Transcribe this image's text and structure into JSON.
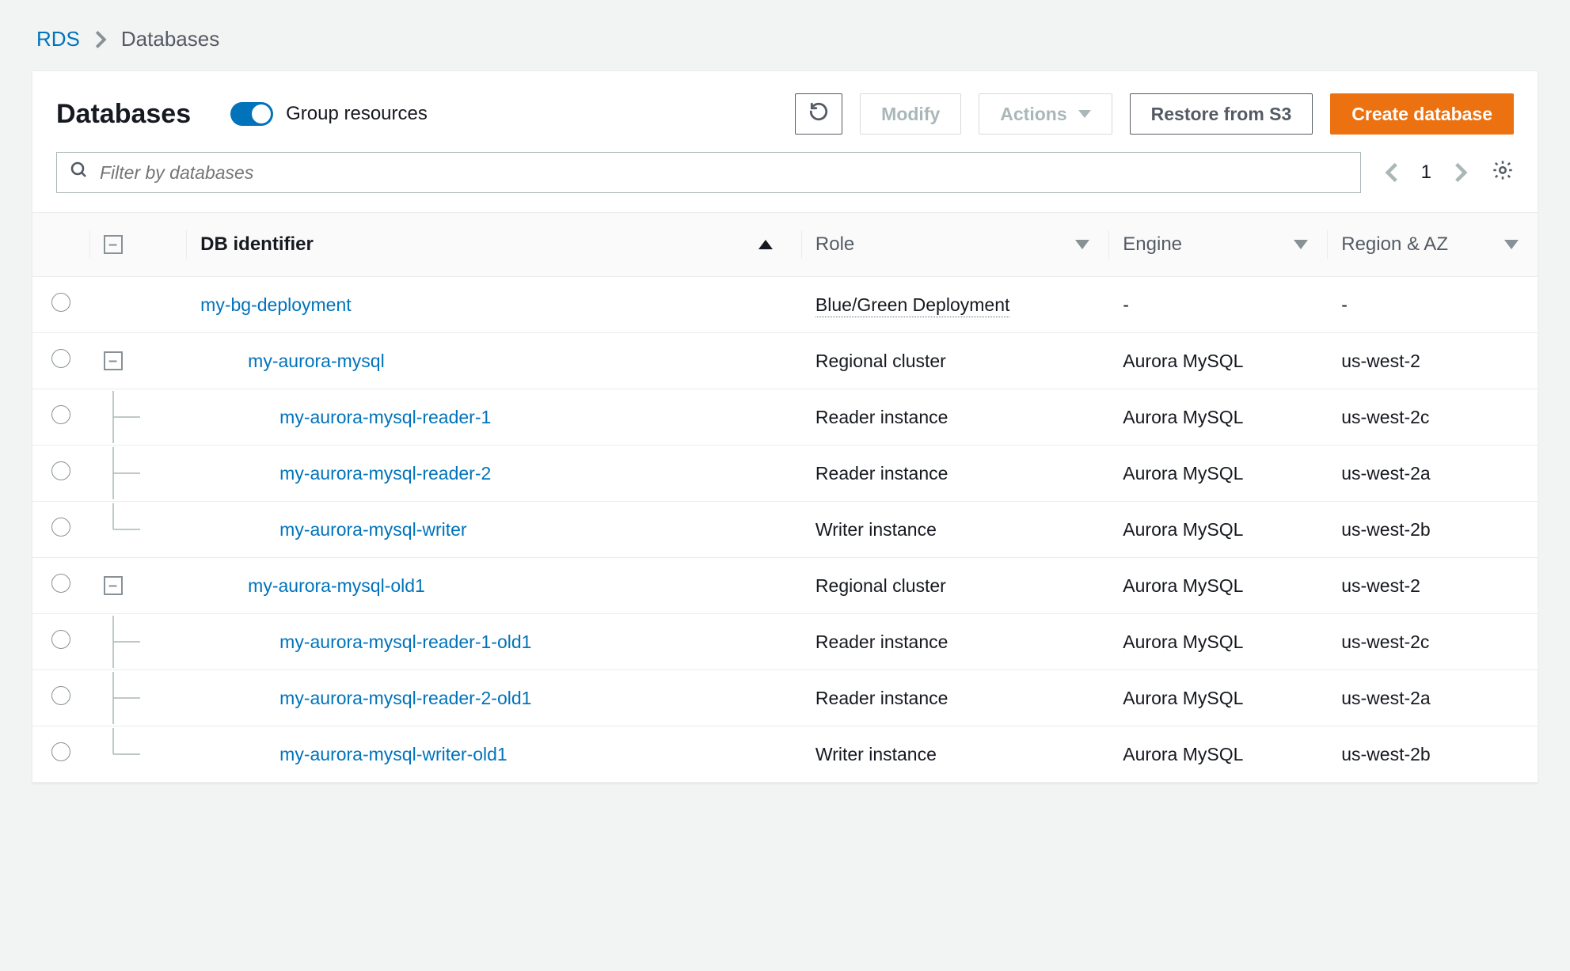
{
  "breadcrumb": {
    "root": "RDS",
    "current": "Databases"
  },
  "header": {
    "title": "Databases",
    "group_toggle_label": "Group resources",
    "buttons": {
      "modify": "Modify",
      "actions": "Actions",
      "restore": "Restore from S3",
      "create": "Create database"
    }
  },
  "search": {
    "placeholder": "Filter by databases"
  },
  "pager": {
    "page": "1"
  },
  "columns": {
    "id": "DB identifier",
    "role": "Role",
    "engine": "Engine",
    "az": "Region & AZ"
  },
  "rows": [
    {
      "indent": 0,
      "expander": "none",
      "name": "my-bg-deployment",
      "role": "Blue/Green Deployment",
      "role_dotted": true,
      "engine": "-",
      "az": "-"
    },
    {
      "indent": 1,
      "expander": "minus",
      "name": "my-aurora-mysql",
      "role": "Regional cluster",
      "engine": "Aurora MySQL",
      "az": "us-west-2"
    },
    {
      "indent": 2,
      "expander": "branch-mid",
      "name": "my-aurora-mysql-reader-1",
      "role": "Reader instance",
      "engine": "Aurora MySQL",
      "az": "us-west-2c"
    },
    {
      "indent": 2,
      "expander": "branch-mid",
      "name": "my-aurora-mysql-reader-2",
      "role": "Reader instance",
      "engine": "Aurora MySQL",
      "az": "us-west-2a"
    },
    {
      "indent": 2,
      "expander": "branch-end",
      "name": "my-aurora-mysql-writer",
      "role": "Writer instance",
      "engine": "Aurora MySQL",
      "az": "us-west-2b"
    },
    {
      "indent": 1,
      "expander": "minus",
      "name": "my-aurora-mysql-old1",
      "role": "Regional cluster",
      "engine": "Aurora MySQL",
      "az": "us-west-2"
    },
    {
      "indent": 2,
      "expander": "branch-mid",
      "name": "my-aurora-mysql-reader-1-old1",
      "role": "Reader instance",
      "engine": "Aurora MySQL",
      "az": "us-west-2c"
    },
    {
      "indent": 2,
      "expander": "branch-mid",
      "name": "my-aurora-mysql-reader-2-old1",
      "role": "Reader instance",
      "engine": "Aurora MySQL",
      "az": "us-west-2a"
    },
    {
      "indent": 2,
      "expander": "branch-end",
      "name": "my-aurora-mysql-writer-old1",
      "role": "Writer instance",
      "engine": "Aurora MySQL",
      "az": "us-west-2b"
    }
  ]
}
